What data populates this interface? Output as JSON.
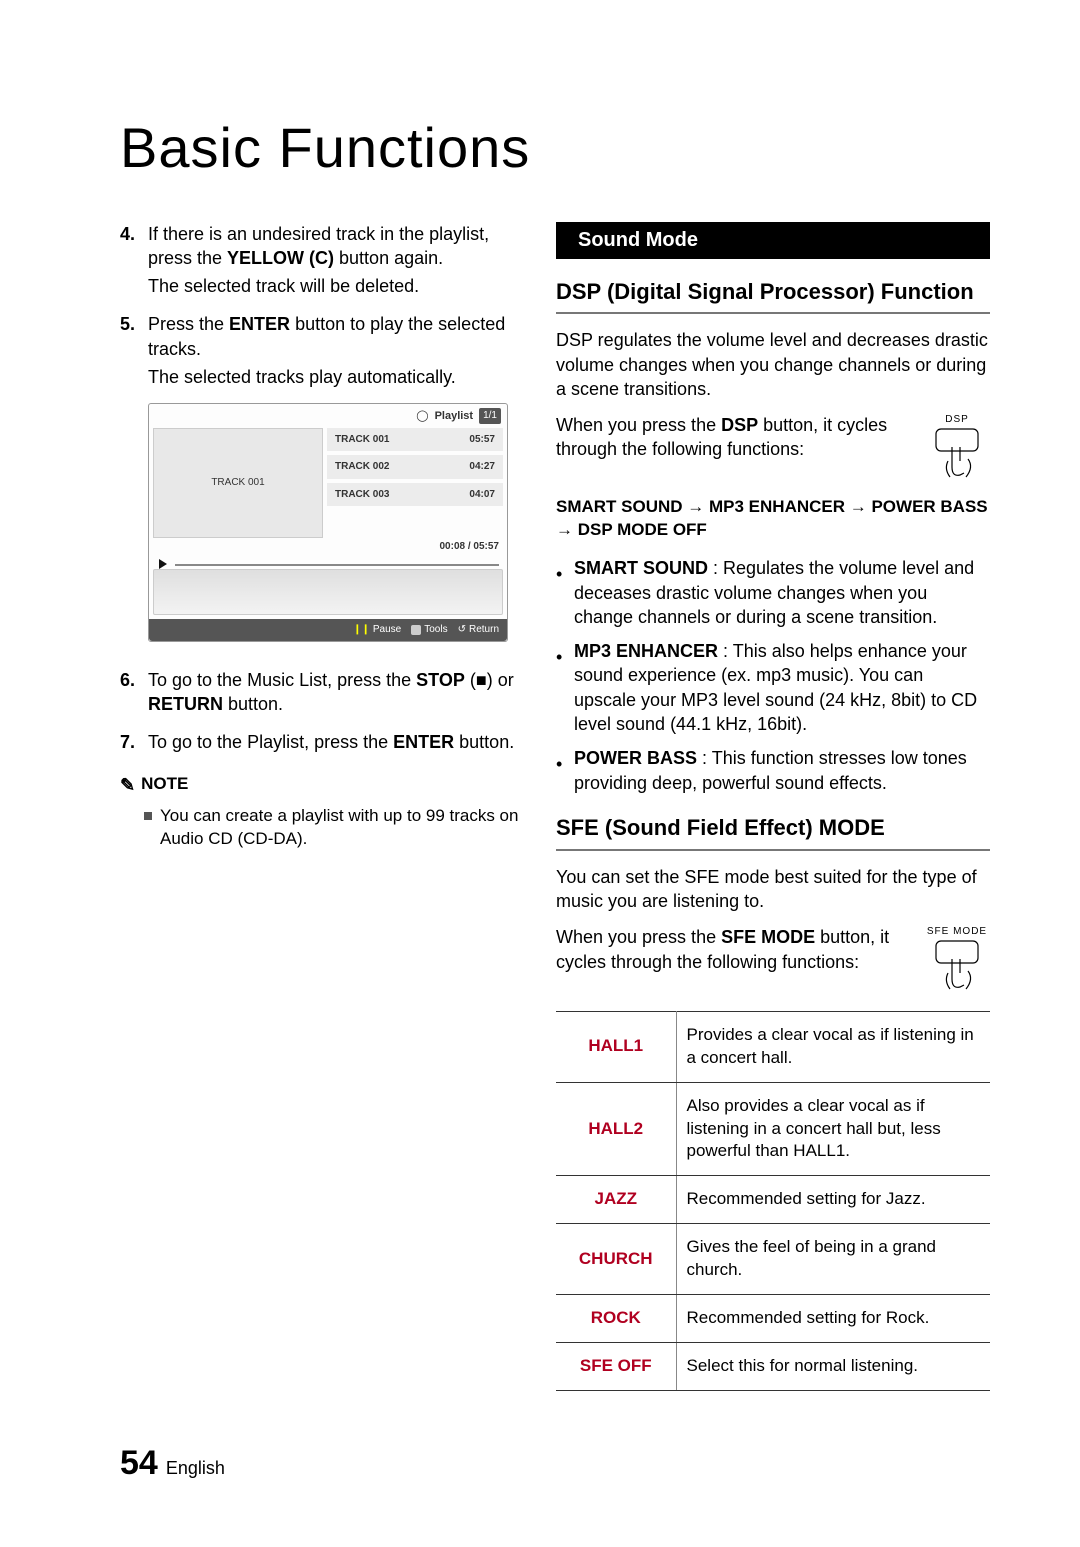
{
  "title": "Basic Functions",
  "left": {
    "items": {
      "n4": {
        "num": "4.",
        "t1": "If there is an undesired track in the playlist, press the ",
        "b1": "YELLOW (C)",
        "t2": " button again.",
        "sub": "The selected track will be deleted."
      },
      "n5": {
        "num": "5.",
        "t1": "Press the ",
        "b1": "ENTER",
        "t2": " button to play the selected tracks.",
        "sub": "The selected tracks play automatically."
      },
      "n6": {
        "num": "6.",
        "t1": "To go to the Music List, press the ",
        "b1": "STOP",
        "t2": " (■) or ",
        "b2": "RETURN",
        "t3": " button."
      },
      "n7": {
        "num": "7.",
        "t1": "To go to the Playlist, press the ",
        "b1": "ENTER",
        "t2": " button."
      }
    },
    "note": {
      "label": "NOTE",
      "text": "You can create a playlist with up to 99 tracks on Audio CD (CD-DA)."
    }
  },
  "playlist": {
    "label": "Playlist",
    "count": "1/1",
    "thumb": "TRACK 001",
    "rows": [
      {
        "name": "TRACK 001",
        "dur": "05:57"
      },
      {
        "name": "TRACK 002",
        "dur": "04:27"
      },
      {
        "name": "TRACK 003",
        "dur": "04:07"
      }
    ],
    "time": "00:08 / 05:57",
    "footer": {
      "pause": "Pause",
      "tools": "Tools",
      "ret": "Return"
    },
    "pauseGlyph": "❙❙"
  },
  "right": {
    "banner": "Sound Mode",
    "dsp": {
      "title": "DSP (Digital Signal Processor) Function",
      "p1": "DSP regulates the volume level and decreases drastic volume changes when you change channels or during a scene transitions.",
      "p2a": "When you press the ",
      "p2b": "DSP",
      "p2c": " button, it cycles through the following functions:",
      "btnLabel": "DSP",
      "chain": "SMART SOUND → MP3 ENHANCER → POWER BASS → DSP MODE OFF",
      "bullets": [
        {
          "b": "SMART SOUND",
          "t": " : Regulates the volume level and deceases drastic volume changes when you change channels or during a scene transition."
        },
        {
          "b": "MP3 ENHANCER",
          "t": " : This also helps enhance your sound experience (ex. mp3 music). You can upscale your MP3 level sound (24 kHz, 8bit) to CD level sound (44.1 kHz, 16bit)."
        },
        {
          "b": "POWER BASS",
          "t": " : This function stresses low tones providing deep, powerful sound effects."
        }
      ]
    },
    "sfe": {
      "title": "SFE (Sound Field Effect) MODE",
      "p1": "You can set the SFE mode best suited for the type of music you are listening to.",
      "p2a": "When you press the ",
      "p2b": "SFE MODE",
      "p2c": " button, it cycles through the following functions:",
      "btnLabel": "SFE MODE",
      "table": [
        {
          "k": "HALL1",
          "v": "Provides a clear vocal as if listening in a concert hall."
        },
        {
          "k": "HALL2",
          "v": "Also provides a clear vocal as if listening in a concert hall but, less powerful than HALL1."
        },
        {
          "k": "JAZZ",
          "v": "Recommended setting for Jazz."
        },
        {
          "k": "CHURCH",
          "v": "Gives the feel of being in a grand church."
        },
        {
          "k": "ROCK",
          "v": "Recommended setting for Rock."
        },
        {
          "k": "SFE OFF",
          "v": "Select this for normal listening."
        }
      ]
    }
  },
  "footer": {
    "page": "54",
    "lang": "English"
  }
}
